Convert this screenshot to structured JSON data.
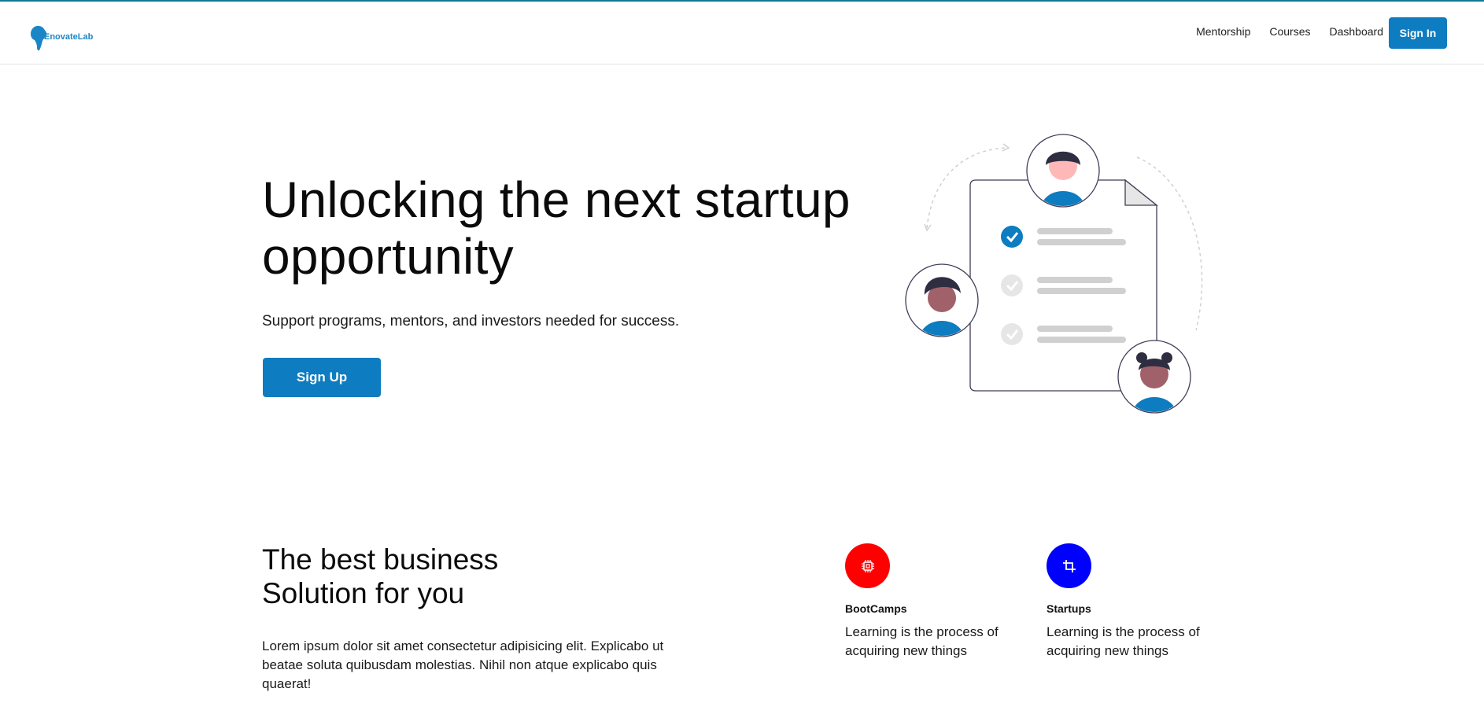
{
  "header": {
    "logo_text": "EnovateLab",
    "nav": [
      "Mentorship",
      "Courses",
      "Dashboard"
    ],
    "signin_label": "Sign In"
  },
  "hero": {
    "title": "Unlocking the next startup opportunity",
    "subtitle": "Support programs, mentors, and investors needed for success.",
    "cta_label": "Sign Up",
    "illustration": "checklist-with-people-illustration"
  },
  "section": {
    "title": "The best business Solution for you",
    "body": "Lorem ipsum dolor sit amet consectetur adipisicing elit. Explicabo ut beatae soluta quibusdam molestias. Nihil non atque explicabo quis quaerat!"
  },
  "features": [
    {
      "title": "BootCamps",
      "desc": "Learning is the process of acquiring new things",
      "icon": "chip-icon",
      "color": "#ff0000"
    },
    {
      "title": "Startups",
      "desc": "Learning is the process of acquiring new things",
      "icon": "crop-icon",
      "color": "#0000ff"
    }
  ],
  "colors": {
    "accent": "#0d7cc0",
    "topline": "#0e7a94"
  }
}
